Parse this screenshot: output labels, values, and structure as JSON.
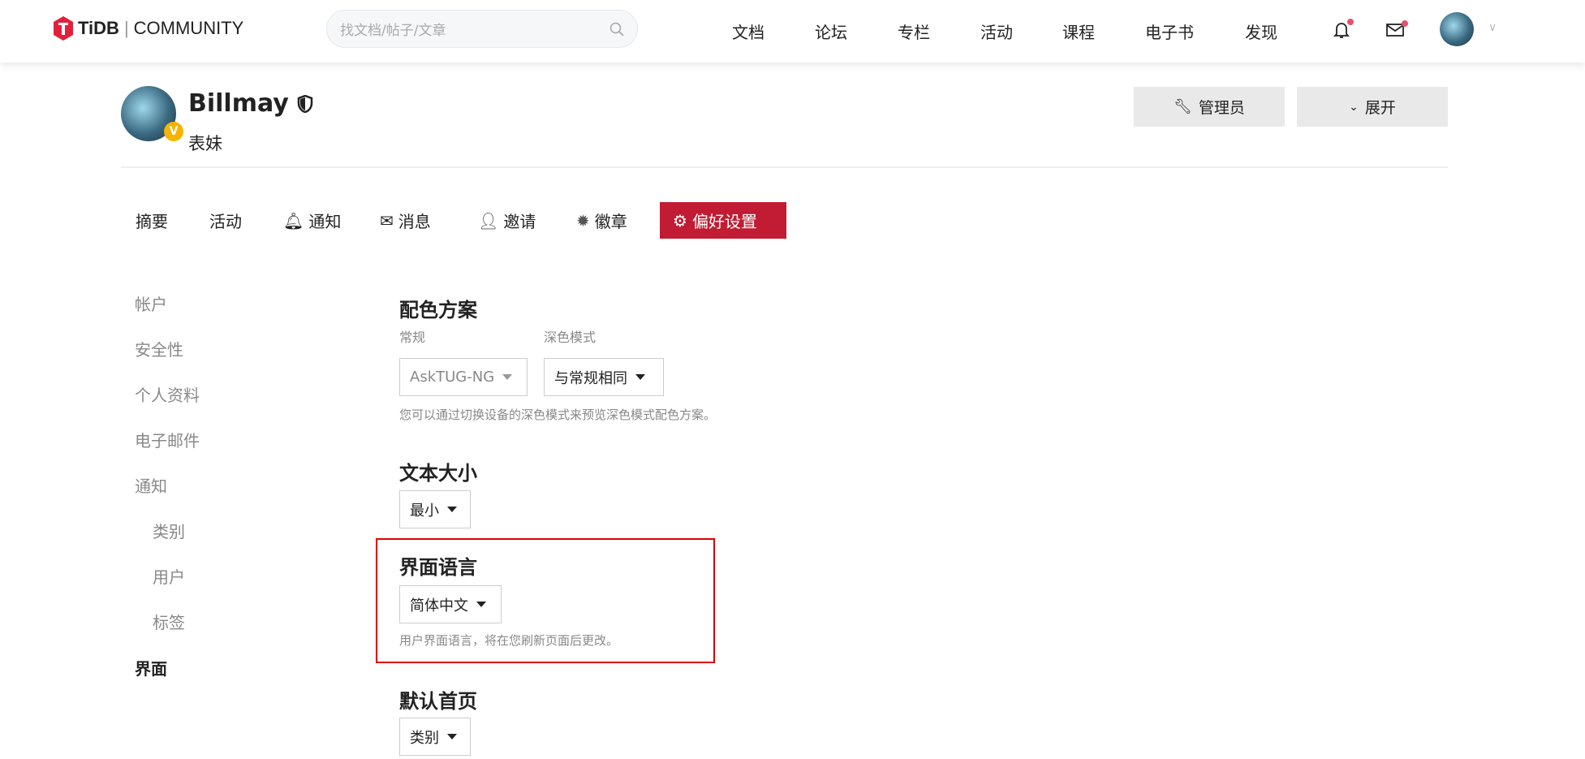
{
  "header": {
    "logo_brand": "TiDB",
    "logo_text": "COMMUNITY",
    "search_placeholder": "找文档/帖子/文章",
    "nav": [
      "文档",
      "论坛",
      "专栏",
      "活动",
      "课程",
      "电子书",
      "发现"
    ]
  },
  "profile": {
    "username": "Billmay",
    "title": "表妹",
    "badge": "V",
    "buttons": {
      "admin": "管理员",
      "expand": "展开"
    }
  },
  "tabs": [
    "摘要",
    "活动",
    "通知",
    "消息",
    "邀请",
    "徽章",
    "偏好设置"
  ],
  "sidebar": [
    "帐户",
    "安全性",
    "个人资料",
    "电子邮件",
    "通知",
    "类别",
    "用户",
    "标签",
    "界面"
  ],
  "content": {
    "color_scheme": {
      "title": "配色方案",
      "regular_label": "常规",
      "dark_label": "深色模式",
      "regular_value": "AskTUG-NG",
      "dark_value": "与常规相同",
      "help": "您可以通过切换设备的深色模式来预览深色模式配色方案。"
    },
    "text_size": {
      "title": "文本大小",
      "value": "最小"
    },
    "language": {
      "title": "界面语言",
      "value": "简体中文",
      "help": "用户界面语言，将在您刷新页面后更改。"
    },
    "homepage": {
      "title": "默认首页",
      "value": "类别"
    }
  },
  "colors": {
    "accent": "#c11c33",
    "highlight": "#e00000"
  }
}
